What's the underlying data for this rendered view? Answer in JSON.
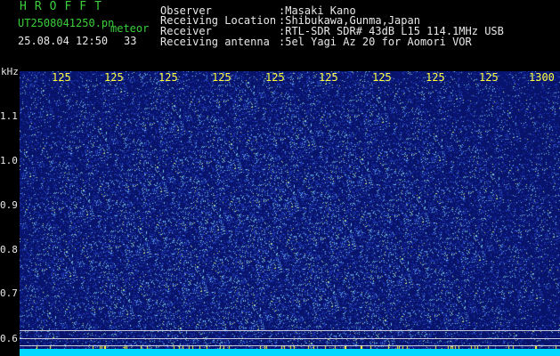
{
  "header": {
    "program_title": "HROFFT",
    "file_name": "UT2508041250.pn",
    "file_type": "meteor",
    "timestamp": "25.08.04 12:50",
    "meteor_count": "33"
  },
  "station_info": [
    {
      "label": "Observer",
      "value": ":Masaki Kano"
    },
    {
      "label": "Receiving Location",
      "value": ":Shibukawa,Gunma,Japan"
    },
    {
      "label": "Receiver",
      "value": ":RTL-SDR SDR# 43dB L15 114.1MHz USB"
    },
    {
      "label": "Receiving antenna",
      "value": ":5el Yagi Az 20 for Aomori VOR"
    }
  ],
  "y_axis": {
    "unit_label": "kHz",
    "ticks": [
      "1.1",
      "1.0",
      "0.9",
      "0.8",
      "0.7",
      "0.6"
    ]
  },
  "x_axis": {
    "ticks": [
      "125",
      "125",
      "125",
      "125",
      "125",
      "125",
      "125",
      "125",
      "125",
      "1300"
    ]
  },
  "colors": {
    "background": "#000000",
    "spectrogram_base": "#0a1a6e",
    "title_green": "#3ccf3c",
    "tick_yellow": "#ffff40",
    "baseline_cyan": "#00d8ff"
  }
}
